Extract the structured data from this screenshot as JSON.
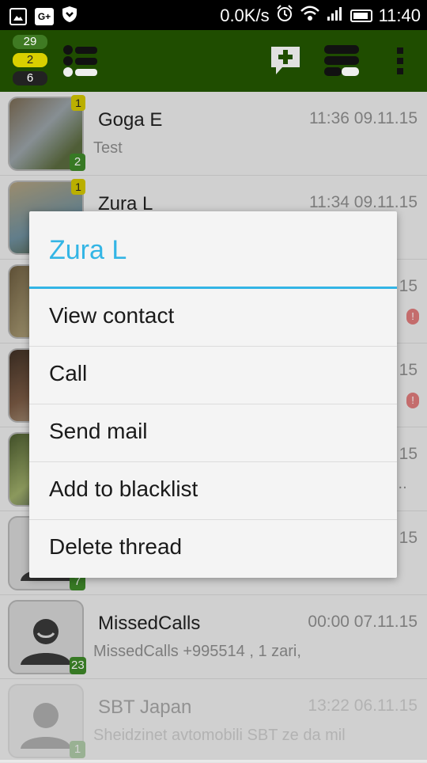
{
  "status_bar": {
    "left_icons": [
      "image-icon",
      "google-plus-icon",
      "shield-icon"
    ],
    "google_plus_label": "G+",
    "network_speed": "0.0K/s",
    "time": "11:40",
    "right_icons": [
      "alarm-icon",
      "wifi-icon",
      "signal-icon",
      "battery-icon"
    ]
  },
  "toolbar": {
    "counters": [
      "29",
      "2",
      "6"
    ],
    "icons": [
      "list-menu-icon",
      "new-message-icon",
      "view-toggle-icon",
      "overflow-menu-icon"
    ],
    "colors": {
      "background": "#1f4d00",
      "counter_green": "#3f7a23",
      "counter_yellow": "#d9cf00",
      "counter_dark": "#222222"
    }
  },
  "threads": [
    {
      "name": "Goga E",
      "time": "11:36 09.11.15",
      "preview": "Test",
      "unread": "1",
      "count": "2"
    },
    {
      "name": "Zura L",
      "time": "11:34 09.11.15",
      "preview": "",
      "unread": "1",
      "count": ""
    },
    {
      "name": "",
      "time": "15",
      "preview": "",
      "unread": "",
      "count": "",
      "warning": "!"
    },
    {
      "name": "",
      "time": "15",
      "preview": "",
      "unread": "",
      "count": "",
      "warning": "!"
    },
    {
      "name": "",
      "time": "15",
      "preview": "...",
      "unread": "",
      "count": ""
    },
    {
      "name": "",
      "time": "15",
      "preview": "",
      "unread": "",
      "count": "7"
    },
    {
      "name": "MissedCalls",
      "time": "00:00 07.11.15",
      "preview": "MissedCalls  +995514              , 1 zari,",
      "unread": "",
      "count": "23"
    },
    {
      "name": "SBT Japan",
      "time": "13:22 06.11.15",
      "preview": "Sheidzinet avtomobili SBT ze da mil",
      "unread": "",
      "count": "1"
    }
  ],
  "dialog": {
    "title": "Zura L",
    "items": [
      "View contact",
      "Call",
      "Send mail",
      "Add to blacklist",
      "Delete thread"
    ],
    "accent_color": "#33b5e5"
  }
}
